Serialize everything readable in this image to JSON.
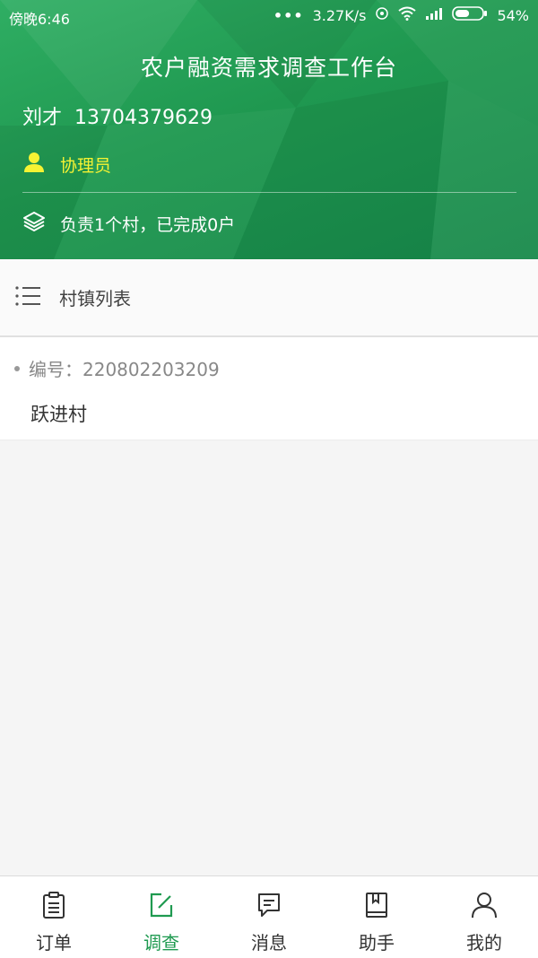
{
  "status_bar": {
    "time": "傍晚6:46",
    "dots": "•••",
    "network_speed": "3.27K/s",
    "battery_percent": "54%",
    "battery_level": 0.54
  },
  "header": {
    "title": "农户融资需求调查工作台",
    "user_name": "刘才",
    "phone": "13704379629",
    "role": "协理员",
    "summary": "负责1个村，已完成0户",
    "colors": {
      "role": "#f6f333",
      "bg": "#1f9850"
    }
  },
  "section": {
    "title": "村镇列表"
  },
  "villages": [
    {
      "code_text": "编号：220802203209",
      "name": "跃进村"
    }
  ],
  "bottom_nav": {
    "items": [
      {
        "label": "订单",
        "icon": "clipboard-icon"
      },
      {
        "label": "调查",
        "icon": "edit-icon",
        "active": true
      },
      {
        "label": "消息",
        "icon": "message-icon"
      },
      {
        "label": "助手",
        "icon": "book-icon"
      },
      {
        "label": "我的",
        "icon": "person-icon"
      }
    ],
    "active_color": "#1f9a50"
  }
}
